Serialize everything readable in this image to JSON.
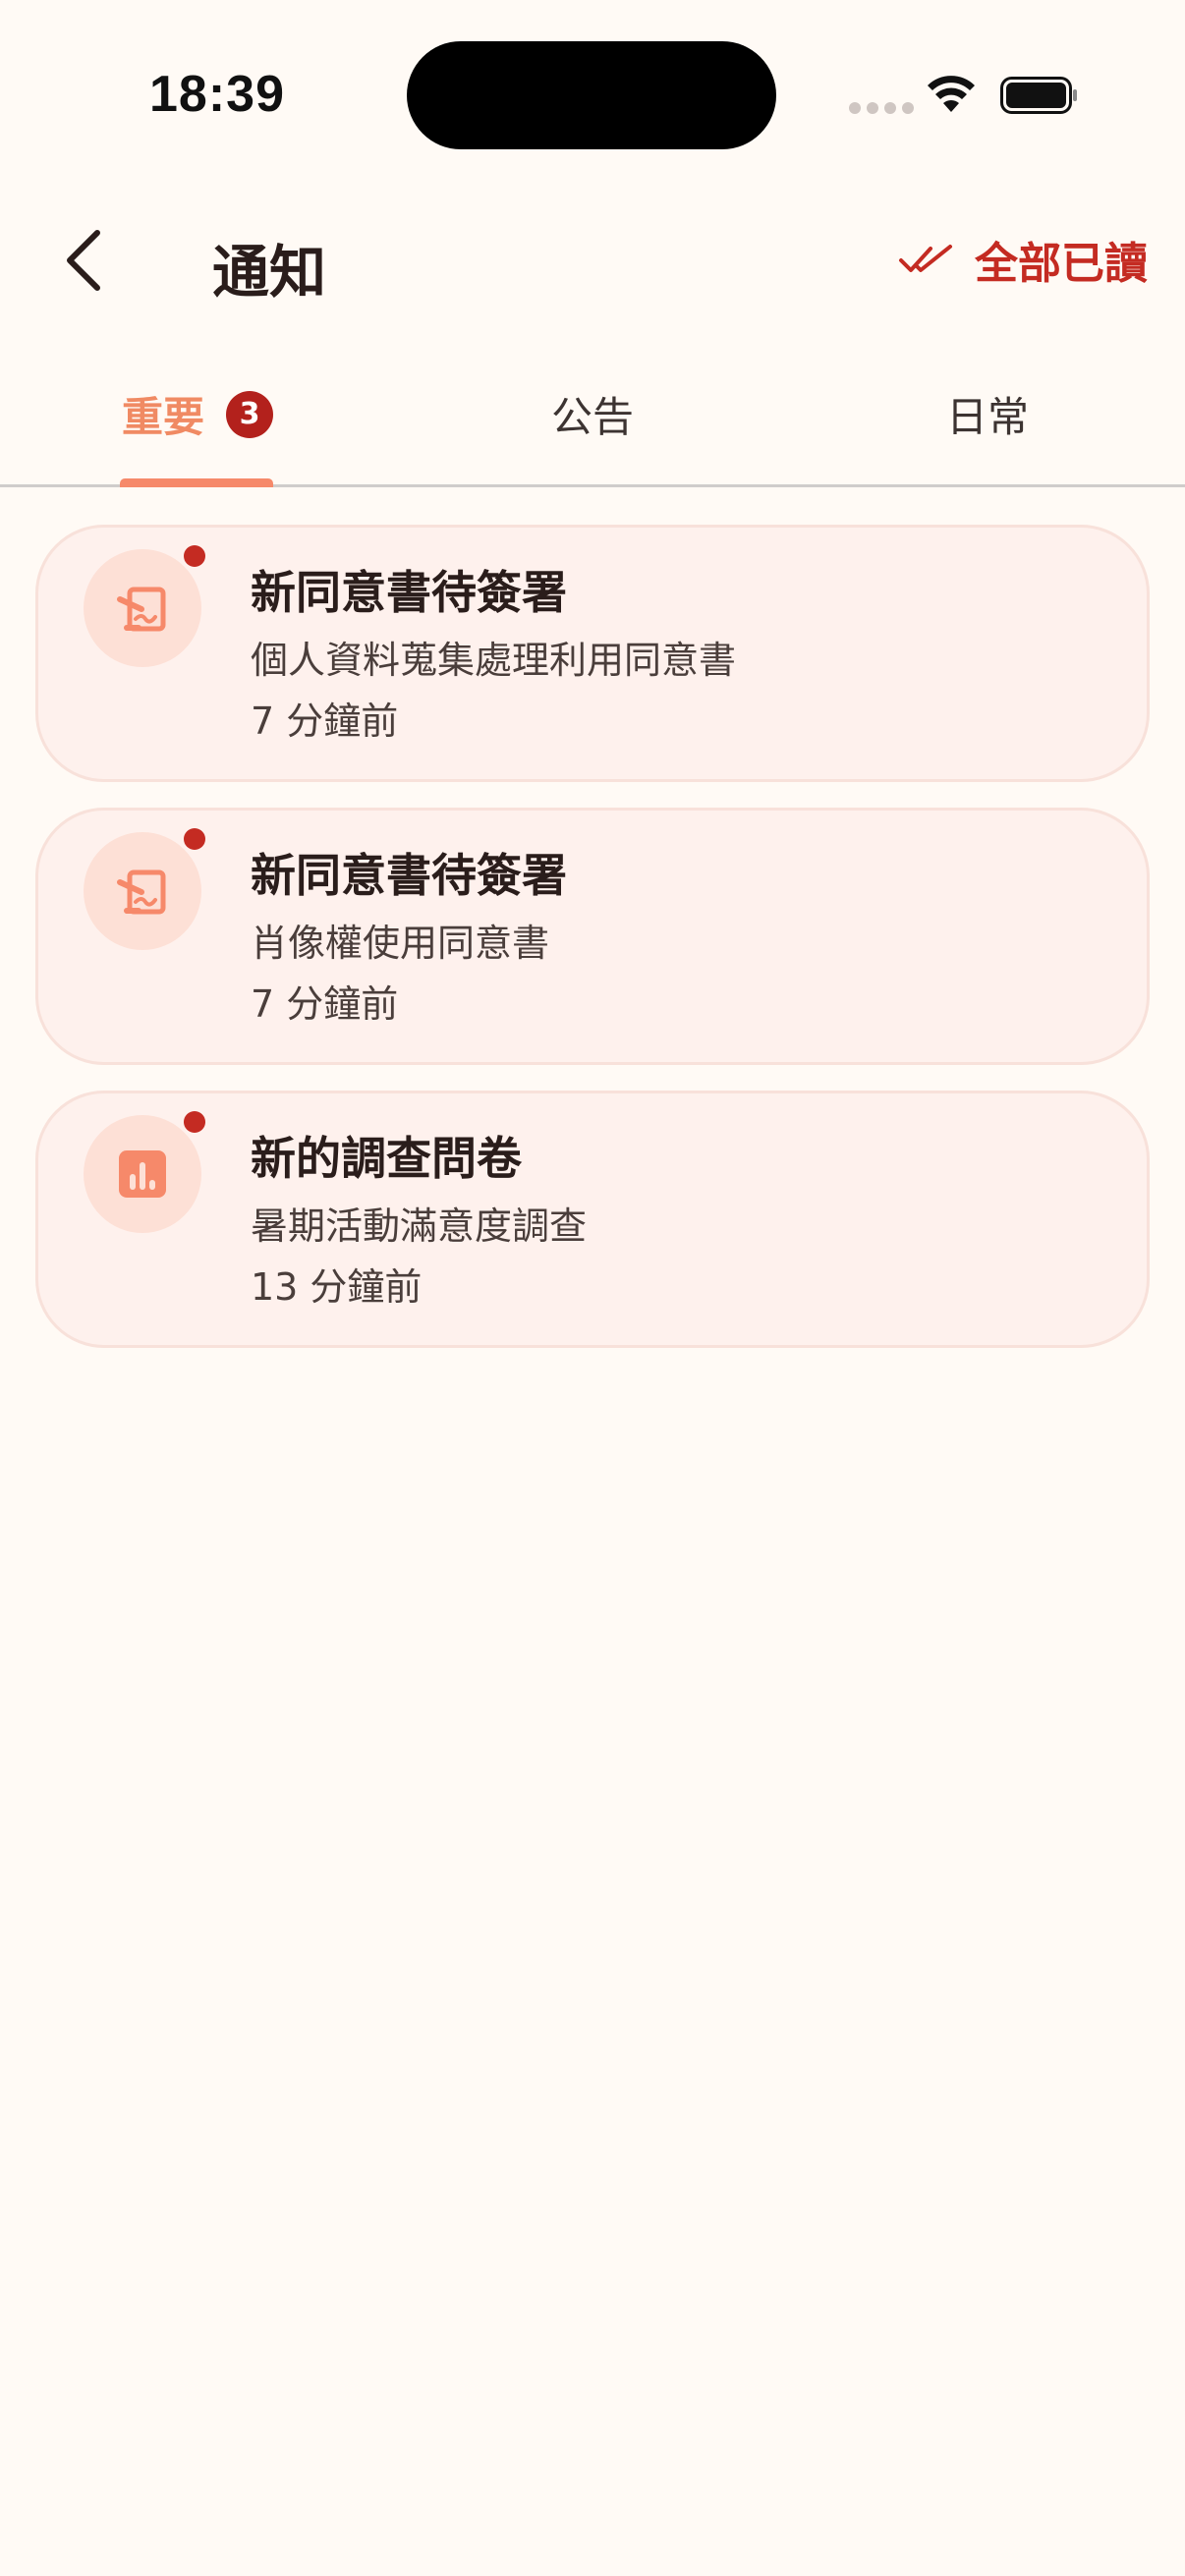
{
  "status_bar": {
    "time": "18:39",
    "wifi_icon": "wifi-icon",
    "battery_icon": "battery-icon"
  },
  "header": {
    "title": "通知",
    "back_icon": "chevron-left-icon",
    "mark_all_read_label": "全部已讀",
    "mark_all_read_icon": "double-check-icon"
  },
  "tabs": [
    {
      "label": "重要",
      "badge": "3",
      "active": true
    },
    {
      "label": "公告",
      "active": false
    },
    {
      "label": "日常",
      "active": false
    }
  ],
  "notifications": [
    {
      "icon": "signature-document-icon",
      "unread": true,
      "title": "新同意書待簽署",
      "subtitle": "個人資料蒐集處理利用同意書",
      "time": "7 分鐘前"
    },
    {
      "icon": "signature-document-icon",
      "unread": true,
      "title": "新同意書待簽署",
      "subtitle": "肖像權使用同意書",
      "time": "7 分鐘前"
    },
    {
      "icon": "bar-chart-icon",
      "unread": true,
      "title": "新的調查問卷",
      "subtitle": "暑期活動滿意度調查",
      "time": "13 分鐘前"
    }
  ],
  "colors": {
    "accent_red": "#c42b22",
    "active_tab": "#f08a63",
    "card_bg": "#fef1ed",
    "icon_orange": "#f6896a",
    "page_bg": "#fffaf5"
  }
}
